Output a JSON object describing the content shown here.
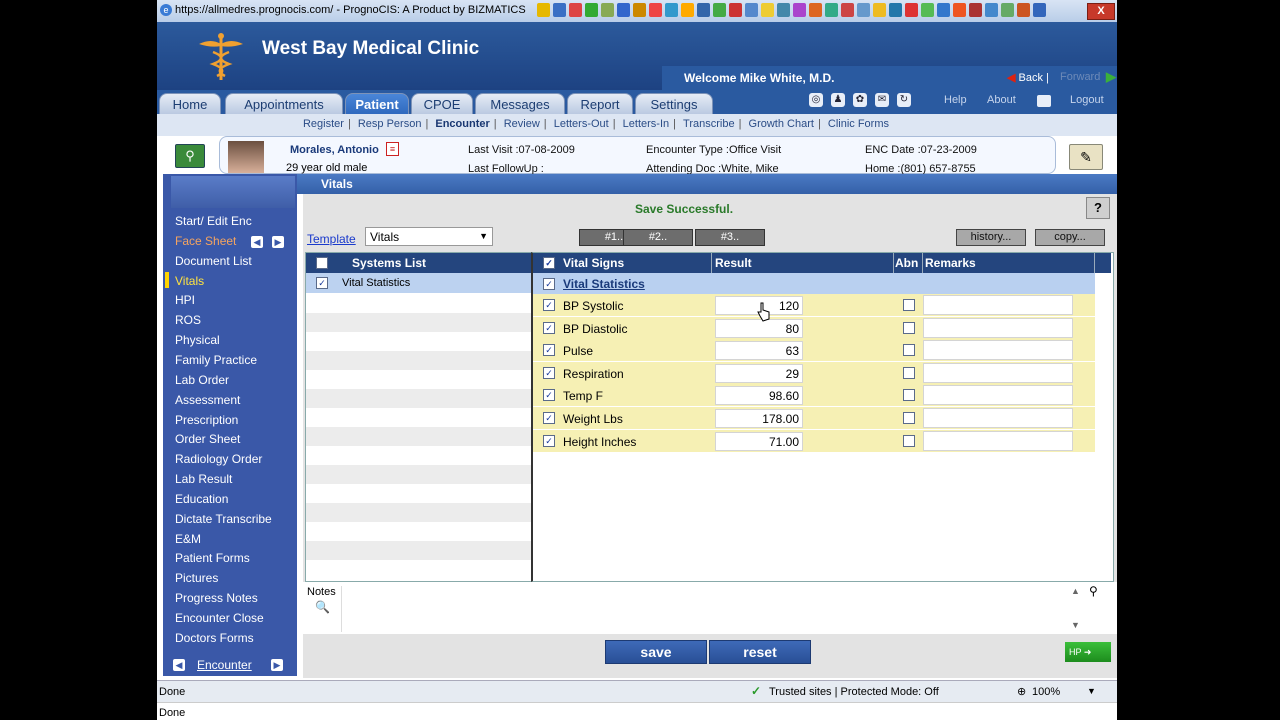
{
  "browser": {
    "title": "https://allmedres.prognocis.com/ - PrognoCIS: A Product by BIZMATICS",
    "close_label": "X",
    "status_left": "Done",
    "status_zone": "Trusted sites | Protected Mode: Off",
    "status_zoom": "100%",
    "bottom_status": "Done"
  },
  "header": {
    "clinic_name": "West Bay Medical Clinic",
    "welcome": "Welcome Mike White, M.D.",
    "back_label": "Back",
    "forward_label": "Forward"
  },
  "tabs": [
    {
      "label": "Home"
    },
    {
      "label": "Appointments"
    },
    {
      "label": "Patient"
    },
    {
      "label": "CPOE"
    },
    {
      "label": "Messages"
    },
    {
      "label": "Report"
    },
    {
      "label": "Settings"
    }
  ],
  "top_links": {
    "help": "Help",
    "about": "About",
    "logout": "Logout"
  },
  "submenu": [
    "Register",
    "Resp Person",
    "Encounter",
    "Review",
    "Letters-Out",
    "Letters-In",
    "Transcribe",
    "Growth Chart",
    "Clinic Forms"
  ],
  "patient": {
    "name": "Morales, Antonio",
    "age_sex": "29 year old male",
    "last_visit": "Last Visit :07-08-2009",
    "last_followup": "Last FollowUp :",
    "encounter_type": "Encounter Type :Office Visit",
    "attending": "Attending Doc :White, Mike",
    "enc_date": "ENC Date :07-23-2009",
    "home_phone": "Home :(801) 657-8755"
  },
  "leftnav": {
    "items": [
      "Start/ Edit Enc",
      "Face Sheet",
      "Document List",
      "Vitals",
      "HPI",
      "ROS",
      "Physical",
      "Family Practice",
      "Lab Order",
      "Assessment",
      "Prescription",
      "Order Sheet",
      "Radiology Order",
      "Lab Result",
      "Education",
      "Dictate Transcribe",
      "E&M",
      "Patient Forms",
      "Pictures",
      "Progress Notes",
      "Encounter Close",
      "Doctors Forms"
    ],
    "footer_label": "Encounter"
  },
  "main": {
    "section_title": "Vitals",
    "save_message": "Save Successful.",
    "help_label": "?",
    "template_label": "Template",
    "template_value": "Vitals",
    "num_buttons": [
      "#1..",
      "#2..",
      "#3.."
    ],
    "history_label": "history...",
    "copy_label": "copy...",
    "systems_header": "Systems List",
    "systems": [
      "Vital Statistics"
    ],
    "vitals_headers": {
      "signs": "Vital Signs",
      "result": "Result",
      "abn": "Abn",
      "remarks": "Remarks"
    },
    "group_label": "Vital Statistics",
    "vitals": [
      {
        "name": "BP Systolic",
        "value": "120"
      },
      {
        "name": "BP Diastolic",
        "value": "80"
      },
      {
        "name": "Pulse",
        "value": "63"
      },
      {
        "name": "Respiration",
        "value": "29"
      },
      {
        "name": "Temp F",
        "value": "98.60"
      },
      {
        "name": "Weight Lbs",
        "value": "178.00"
      },
      {
        "name": "Height Inches",
        "value": "71.00"
      }
    ],
    "notes_label": "Notes",
    "save_label": "save",
    "reset_label": "reset",
    "hp_label": "HP"
  }
}
